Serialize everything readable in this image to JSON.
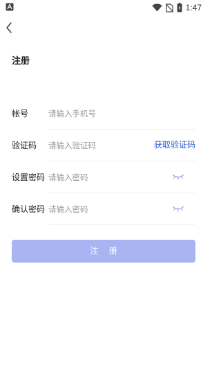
{
  "status_bar": {
    "time": "1:47",
    "icons": [
      "notification-a-icon",
      "wifi-icon",
      "no-sim-icon",
      "battery-icon"
    ]
  },
  "header": {
    "back_icon": "chevron-left-icon",
    "title": "注册"
  },
  "form": {
    "account": {
      "label": "帐号",
      "placeholder": "请输入手机号"
    },
    "code": {
      "label": "验证码",
      "placeholder": "请输入验证码",
      "action_label": "获取验证码"
    },
    "password": {
      "label": "设置密码",
      "placeholder": "请输入密码",
      "toggle_icon": "eye-closed-icon"
    },
    "confirm_password": {
      "label": "确认密码",
      "placeholder": "请输入密码",
      "toggle_icon": "eye-closed-icon"
    }
  },
  "submit": {
    "label": "注 册"
  },
  "colors": {
    "accent_link": "#3060d0",
    "button_disabled": "#aab4f3",
    "divider": "#ededed",
    "placeholder": "#9a9a9a"
  }
}
